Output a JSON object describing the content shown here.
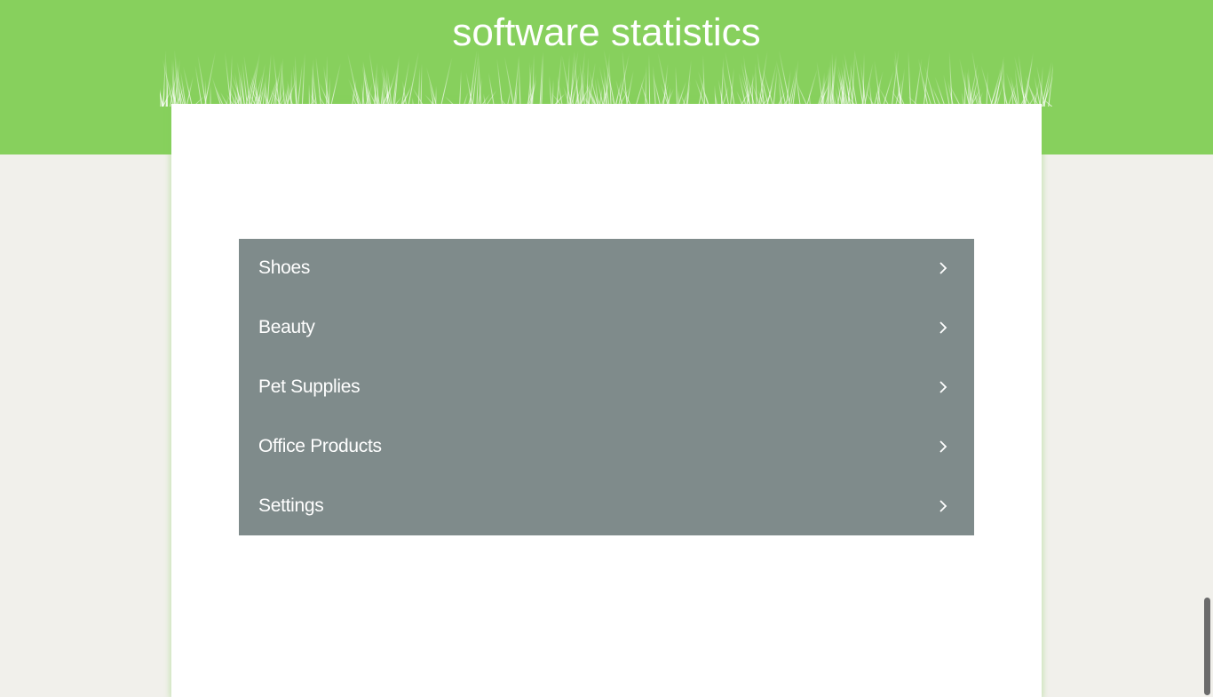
{
  "header": {
    "title": "software statistics"
  },
  "colors": {
    "header_green": "#87d05d",
    "page_background": "#f1f0eb",
    "menu_background": "#7f8b8b",
    "menu_text": "#ffffff"
  },
  "menu": {
    "items": [
      {
        "label": "Shoes",
        "icon": "chevron-right-icon"
      },
      {
        "label": "Beauty",
        "icon": "chevron-right-icon"
      },
      {
        "label": "Pet Supplies",
        "icon": "chevron-right-icon"
      },
      {
        "label": "Office Products",
        "icon": "chevron-right-icon"
      },
      {
        "label": "Settings",
        "icon": "chevron-right-icon"
      }
    ]
  }
}
